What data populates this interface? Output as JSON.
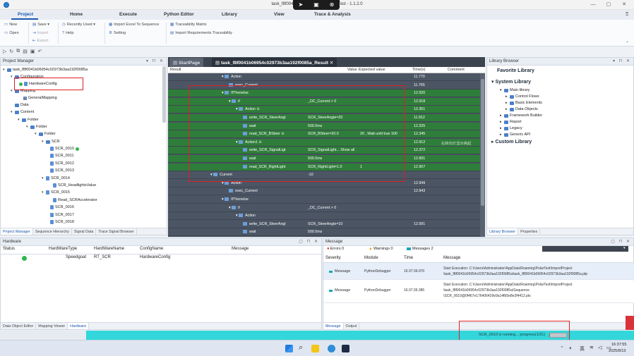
{
  "window": {
    "title": "task_f8f0041b06954c0...sult - PolarTest - 1.1.2.0"
  },
  "menu": {
    "tabs": [
      "Project",
      "Home",
      "Execute",
      "Python Editor",
      "Library",
      "View",
      "Trace & Analysis"
    ]
  },
  "ribbon": {
    "new": "New",
    "open": "Open",
    "save": "Save",
    "import": "Import",
    "export": "Export",
    "recent": "Recently Used",
    "help": "Help",
    "import_excel": "Import Excel To Sequence",
    "setting": "Setting",
    "traceability": "Traceability Matrix",
    "import_req": "Import Requirements Traceability"
  },
  "project_manager": {
    "title": "Project Manager",
    "nodes": {
      "root": "task_f8f0041b06954c02973b3aa192f0085a",
      "configuration": "Configuration",
      "hardware_config": "HardwareConfig",
      "mapping": "Mapping",
      "general_mapping": "GeneralMapping",
      "data": "Data",
      "content": "Content",
      "folder1": "Folder",
      "folder2": "Folder",
      "folder3": "Folder",
      "scr": "SCR",
      "scr_0010": "SCR_0010",
      "scr_0011": "SCR_0011",
      "scr_0012": "SCR_0012",
      "scr_0013": "SCR_0013",
      "scr_0014": "SCR_0014",
      "scr_headlights": "SCR_HeadlightsValue",
      "scr_0015": "SCR_0015",
      "read_scr_acc": "Read_SCRAccelerator",
      "scr_0016": "SCR_0016",
      "scr_0017": "SCR_0017",
      "scr_0018": "SCR_0018"
    },
    "bottom_tabs": [
      "Project Manager",
      "Sequence Hierarchy",
      "Signal Data",
      "Trace Signal Browser"
    ]
  },
  "editor": {
    "tab_start": "StartPage",
    "tab_result": "task_f8f0041b06954c02973b3aa192f0085a_Result",
    "columns": {
      "result": "Result",
      "value": "Value",
      "expected": "Expected value",
      "time": "Time(s)",
      "comment": "Comment"
    },
    "rows": [
      {
        "label": "Action",
        "value": "",
        "expected": "",
        "time": "11.770",
        "comment": ""
      },
      {
        "label": "exec_Current",
        "value": "",
        "expected": "",
        "time": "11.765",
        "comment": ""
      },
      {
        "label": "IfThenelse",
        "value": "",
        "expected": "",
        "time": "12.920",
        "comment": ""
      },
      {
        "label": "if",
        "value": "_DC_Current > 0",
        "expected": "",
        "time": "12.918",
        "comment": ""
      },
      {
        "label": "Action",
        "value": "",
        "expected": "",
        "time": "12.351",
        "comment": ""
      },
      {
        "label": "write_SCR_SteerAngl",
        "value": "SCR_SteerAngle=20",
        "expected": "",
        "time": "11.812",
        "comment": ""
      },
      {
        "label": "wait",
        "value": "500.0ms",
        "expected": "",
        "time": "12.325",
        "comment": ""
      },
      {
        "label": "read_SCR_BSteer",
        "value": "SCR_BSteer=20.0",
        "expected": "20 , Wait until true 100",
        "time": "12.345",
        "comment": ""
      },
      {
        "label": "Action1",
        "value": "",
        "expected": "",
        "time": "12.912",
        "comment": "右转向灯显示亮起"
      },
      {
        "label": "write_SCR_SignalLigt",
        "value": "SCR_SignalLight...  Show all",
        "expected": "",
        "time": "12.372",
        "comment": ""
      },
      {
        "label": "wait",
        "value": "500.0ms",
        "expected": "",
        "time": "12.891",
        "comment": ""
      },
      {
        "label": "read_SCR_RightLight",
        "value": "SCR_RightLight=1.0",
        "expected": "1",
        "time": "12.907",
        "comment": ""
      },
      {
        "label": "Current",
        "value": "-10",
        "expected": "",
        "time": "",
        "comment": ""
      },
      {
        "label": "Action",
        "value": "",
        "expected": "",
        "time": "12.949",
        "comment": ""
      },
      {
        "label": "exec_Current",
        "value": "",
        "expected": "",
        "time": "12.943",
        "comment": ""
      },
      {
        "label": "IfThenelse",
        "value": "",
        "expected": "",
        "time": "",
        "comment": ""
      },
      {
        "label": "if",
        "value": "_DC_Current > 0",
        "expected": "",
        "time": "",
        "comment": ""
      },
      {
        "label": "Action",
        "value": "",
        "expected": "",
        "time": "",
        "comment": ""
      },
      {
        "label": "write_SCR_SteerAngl",
        "value": "SCR_SteerAngle=10",
        "expected": "",
        "time": "12.991",
        "comment": ""
      },
      {
        "label": "wait",
        "value": "500.0ms",
        "expected": "",
        "time": "",
        "comment": ""
      }
    ]
  },
  "library": {
    "title": "Library Browser",
    "favorite": "Favorite Library",
    "system": "System Library",
    "main": "Main library",
    "control_flows": "Control Flows",
    "basic_elements": "Basic Elements",
    "data_objects": "Data Objects",
    "framework_builder": "Framework Builder",
    "report": "Report",
    "legacy": "Legacy",
    "generic_api": "Generic API",
    "custom": "Custom Library",
    "bottom_tabs": [
      "Library Browser",
      "Properties"
    ]
  },
  "hardware": {
    "title": "Hardware",
    "columns": [
      "Status",
      "HardWareType",
      "HardWareName",
      "ConfigName",
      "Message"
    ],
    "row": {
      "type": "Speedgoat",
      "name": "RT_SCR",
      "config": "HardwareConfig",
      "message": ""
    },
    "bottom_tabs": [
      "Data Object Editor",
      "Mapping Viewer",
      "Hardware"
    ]
  },
  "messages": {
    "title": "Message",
    "filters": {
      "errors": "Errors 0",
      "warnings": "Warnings 0",
      "messages": "Messages 2"
    },
    "columns": [
      "Severity",
      "Module",
      "Time",
      "Message"
    ],
    "rows": [
      {
        "severity": "Message",
        "module": "PythonDebugger",
        "time": "16:37:39.070",
        "line1": "Start Execution: C:\\Users\\Administrator\\AppData\\Roaming\\PolarTest\\ImportProject",
        "line2": "\\task_f8f0041b06954c02973b3aa192f0085a\\task_f8f0041b06954c02973b3aa192f0085a.ptp"
      },
      {
        "severity": "Message",
        "module": "PythonDebugger",
        "time": "16:37:39.385",
        "line1": "Start Execution: C:\\Users\\Administrator\\AppData\\Roaming\\PolarTest\\ImportProject",
        "line2": "\\task_f8f0041b06954c02973b3aa192f0085a\\Sequence",
        "line3": "\\SCR_0010@0f467e176406429e9a14fb5e8e2f4412.pts"
      }
    ],
    "bottom_tabs": [
      "Message",
      "Output"
    ]
  },
  "status": {
    "text": "SCR_0010 is running... progress(1/21)",
    "progress": 0.048
  },
  "taskbar": {
    "lang": "英",
    "time": "16:37:55",
    "date": "2025/8/13"
  },
  "colors": {
    "accent": "#1a56b0",
    "pass_row": "#2f7d3a",
    "grid_bg": "#4b5563",
    "status_bar": "#33d6da",
    "highlight_box": "#e02020"
  }
}
